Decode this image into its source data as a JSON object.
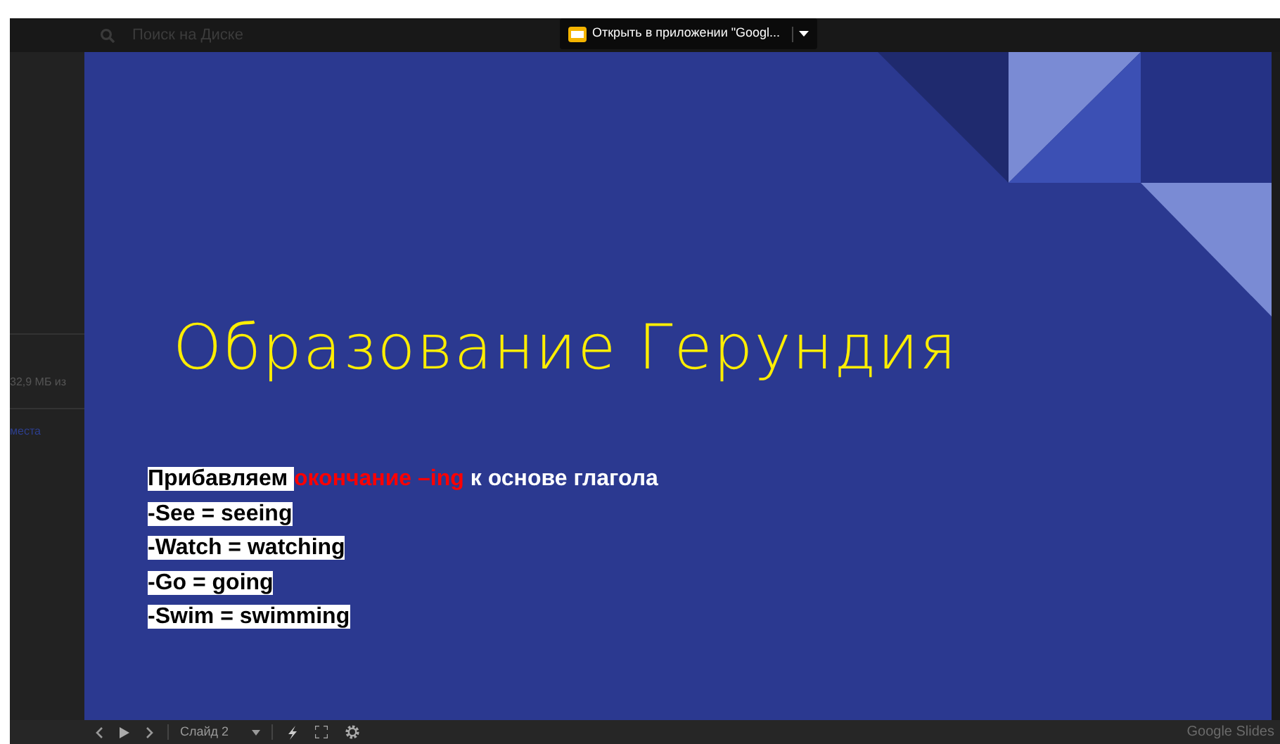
{
  "top_bar": {
    "search": {
      "placeholder": "Поиск на Диске"
    },
    "open_button": {
      "label": "Открыть в приложении \"Googl..."
    }
  },
  "side_panel": {
    "texts": [
      "32,9 МБ из",
      "места"
    ]
  },
  "slide": {
    "title": "Образование Герундия",
    "lines": [
      {
        "runs": [
          {
            "kind": "highlight",
            "text": "Прибавляем "
          },
          {
            "kind": "red",
            "text": "окончание –ing"
          },
          {
            "kind": "plain",
            "text": " к основе глагола"
          }
        ]
      },
      {
        "runs": [
          {
            "kind": "highlight",
            "text": "-See = seeing"
          }
        ]
      },
      {
        "runs": [
          {
            "kind": "highlight",
            "text": "-Watch = watching"
          }
        ]
      },
      {
        "runs": [
          {
            "kind": "highlight",
            "text": "-Go = going"
          }
        ]
      },
      {
        "runs": [
          {
            "kind": "highlight",
            "text": "-Swim = swimming"
          }
        ]
      }
    ]
  },
  "toolbar": {
    "slide_select": "Слайд 2",
    "brand": "Google Slides"
  }
}
